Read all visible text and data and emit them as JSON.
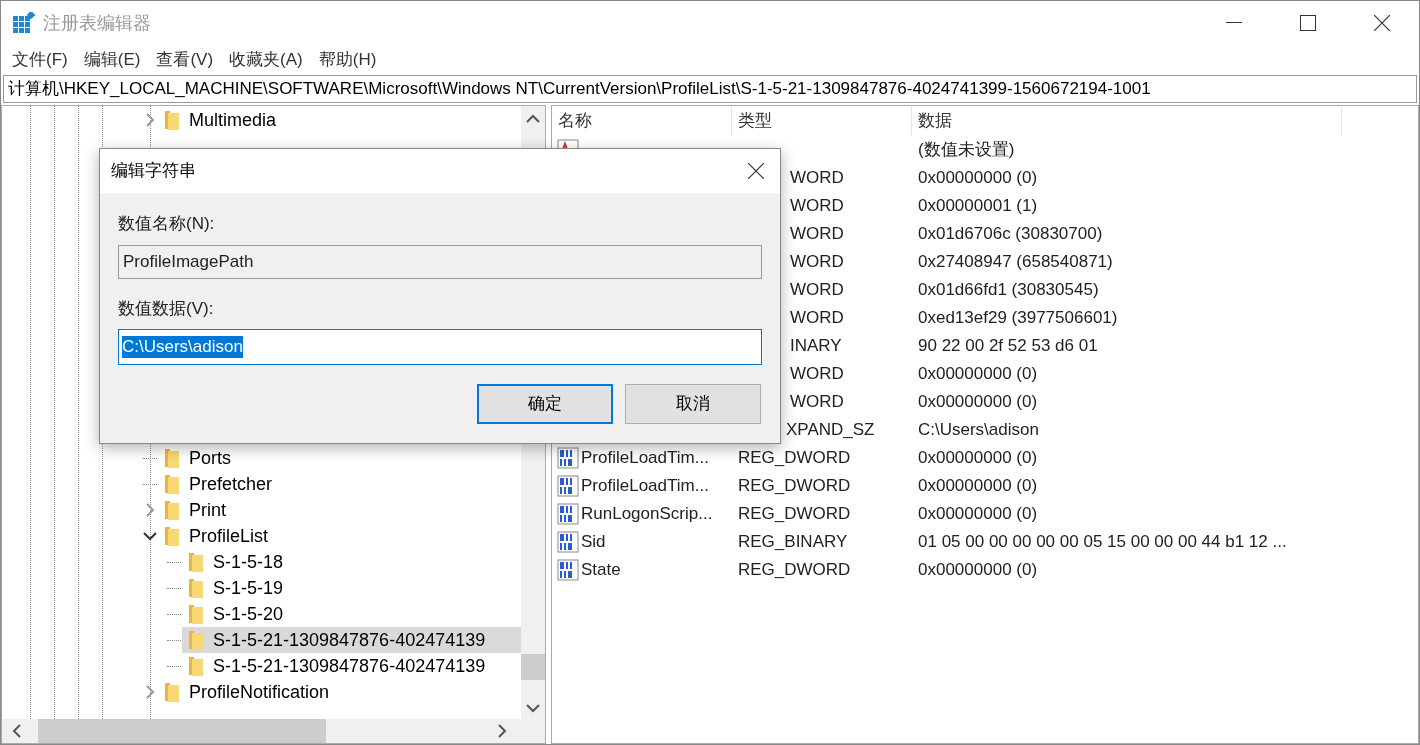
{
  "window": {
    "title": "注册表编辑器"
  },
  "menu": [
    "文件(F)",
    "编辑(E)",
    "查看(V)",
    "收藏夹(A)",
    "帮助(H)"
  ],
  "address": "计算机\\HKEY_LOCAL_MACHINE\\SOFTWARE\\Microsoft\\Windows NT\\CurrentVersion\\ProfileList\\S-1-5-21-1309847876-4024741399-1560672194-1001",
  "tree": {
    "items": [
      {
        "label": "Multimedia",
        "kind": "closed",
        "selected": false
      },
      {
        "label": "Ports",
        "kind": "leaf",
        "selected": false
      },
      {
        "label": "Prefetcher",
        "kind": "leaf",
        "selected": false
      },
      {
        "label": "Print",
        "kind": "closed",
        "selected": false
      },
      {
        "label": "ProfileList",
        "kind": "open",
        "selected": false,
        "children": [
          {
            "label": "S-1-5-18",
            "kind": "leaf",
            "selected": false
          },
          {
            "label": "S-1-5-19",
            "kind": "leaf",
            "selected": false
          },
          {
            "label": "S-1-5-20",
            "kind": "leaf",
            "selected": false
          },
          {
            "label": "S-1-5-21-1309847876-402474139",
            "kind": "leaf",
            "selected": true
          },
          {
            "label": "S-1-5-21-1309847876-402474139",
            "kind": "leaf",
            "selected": false
          }
        ]
      },
      {
        "label": "ProfileNotification",
        "kind": "closed",
        "selected": false
      }
    ]
  },
  "list": {
    "columns": [
      "名称",
      "类型",
      "数据"
    ],
    "rows": [
      {
        "kind": "string",
        "data": "(数值未设置)"
      },
      {
        "type": "WORD",
        "data": "0x00000000 (0)"
      },
      {
        "type": "WORD",
        "data": "0x00000001 (1)"
      },
      {
        "type": "WORD",
        "data": "0x01d6706c (30830700)"
      },
      {
        "type": "WORD",
        "data": "0x27408947 (658540871)"
      },
      {
        "type": "WORD",
        "data": "0x01d66fd1 (30830545)"
      },
      {
        "type": "WORD",
        "data": "0xed13ef29 (3977506601)"
      },
      {
        "type": "INARY",
        "data": "90 22 00 2f 52 53 d6 01"
      },
      {
        "type": "WORD",
        "data": "0x00000000 (0)"
      },
      {
        "type": "WORD",
        "data": "0x00000000 (0)"
      },
      {
        "type": "XPAND_SZ",
        "data": "C:\\Users\\adison"
      },
      {
        "kind": "binary",
        "name": "ProfileLoadTim...",
        "type": "REG_DWORD",
        "data": "0x00000000 (0)"
      },
      {
        "kind": "binary",
        "name": "ProfileLoadTim...",
        "type": "REG_DWORD",
        "data": "0x00000000 (0)"
      },
      {
        "kind": "binary",
        "name": "RunLogonScrip...",
        "type": "REG_DWORD",
        "data": "0x00000000 (0)"
      },
      {
        "kind": "binary",
        "name": "Sid",
        "type": "REG_BINARY",
        "data": "01 05 00 00 00 00 00 05 15 00 00 00 44 b1 12 ..."
      },
      {
        "kind": "binary",
        "name": "State",
        "type": "REG_DWORD",
        "data": "0x00000000 (0)"
      }
    ]
  },
  "dialog": {
    "title": "编辑字符串",
    "name_label": "数值名称(N):",
    "name_value": "ProfileImagePath",
    "data_label": "数值数据(V):",
    "data_value": "C:\\Users\\adison",
    "data_selected": true,
    "buttons": [
      {
        "label": "确定",
        "default": true
      },
      {
        "label": "取消",
        "default": false
      }
    ]
  }
}
